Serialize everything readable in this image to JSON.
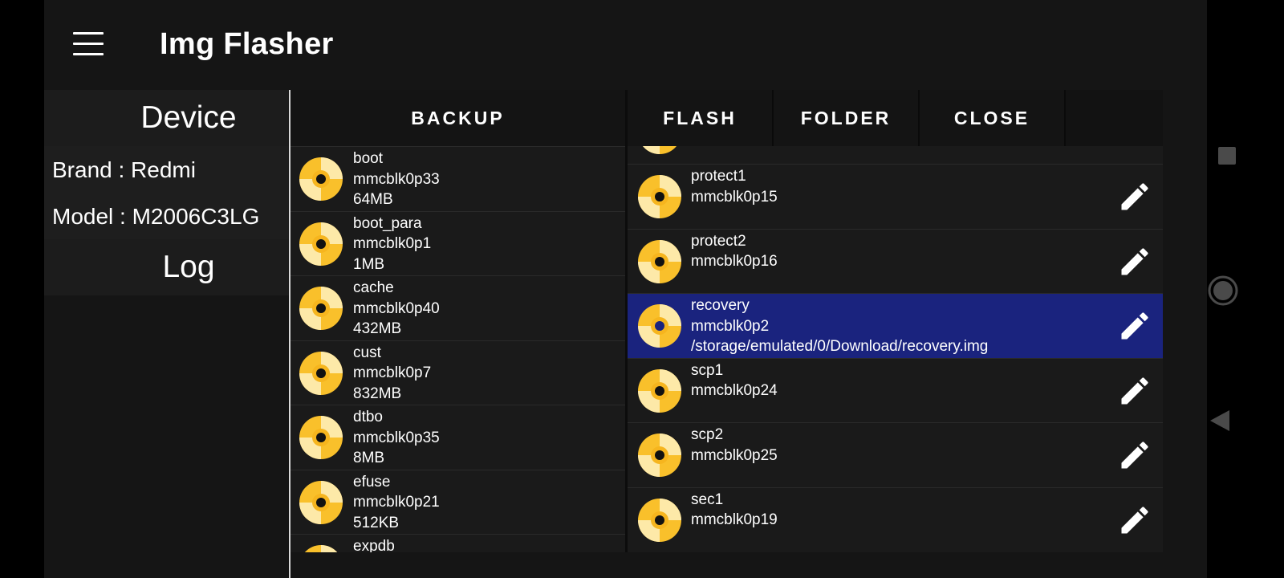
{
  "app": {
    "title": "Img Flasher",
    "accent_selected_color": "#1a237e",
    "disc_color": "#f9c02b"
  },
  "topbar": {
    "menu_icon": "hamburger-menu-icon"
  },
  "device_panel": {
    "header": "Device",
    "brand": "Brand : Redmi",
    "model": "Model : M2006C3LG",
    "log_header": "Log"
  },
  "backup": {
    "tab_label": "BACKUP",
    "items": [
      {
        "name": "boot",
        "device": "mmcblk0p33",
        "size": "64MB"
      },
      {
        "name": "boot_para",
        "device": "mmcblk0p1",
        "size": "1MB"
      },
      {
        "name": "cache",
        "device": "mmcblk0p40",
        "size": "432MB"
      },
      {
        "name": "cust",
        "device": "mmcblk0p7",
        "size": "832MB"
      },
      {
        "name": "dtbo",
        "device": "mmcblk0p35",
        "size": "8MB"
      },
      {
        "name": "efuse",
        "device": "mmcblk0p21",
        "size": "512KB"
      },
      {
        "name": "expdb",
        "device": "",
        "size": ""
      }
    ]
  },
  "flash": {
    "tabs": [
      {
        "label": "FLASH"
      },
      {
        "label": "FOLDER"
      },
      {
        "label": "CLOSE"
      }
    ],
    "items": [
      {
        "name": "protect1",
        "device": "mmcblk0p15",
        "path": "",
        "selected": false
      },
      {
        "name": "protect2",
        "device": "mmcblk0p16",
        "path": "",
        "selected": false
      },
      {
        "name": "recovery",
        "device": "mmcblk0p2",
        "path": "/storage/emulated/0/Download/recovery.img",
        "selected": true
      },
      {
        "name": "scp1",
        "device": "mmcblk0p24",
        "path": "",
        "selected": false
      },
      {
        "name": "scp2",
        "device": "mmcblk0p25",
        "path": "",
        "selected": false
      },
      {
        "name": "sec1",
        "device": "mmcblk0p19",
        "path": "",
        "selected": false
      }
    ],
    "edit_icon": "pencil-edit-icon"
  },
  "navbar": {
    "buttons": [
      "recents-square-icon",
      "home-circle-icon",
      "back-triangle-icon"
    ]
  }
}
